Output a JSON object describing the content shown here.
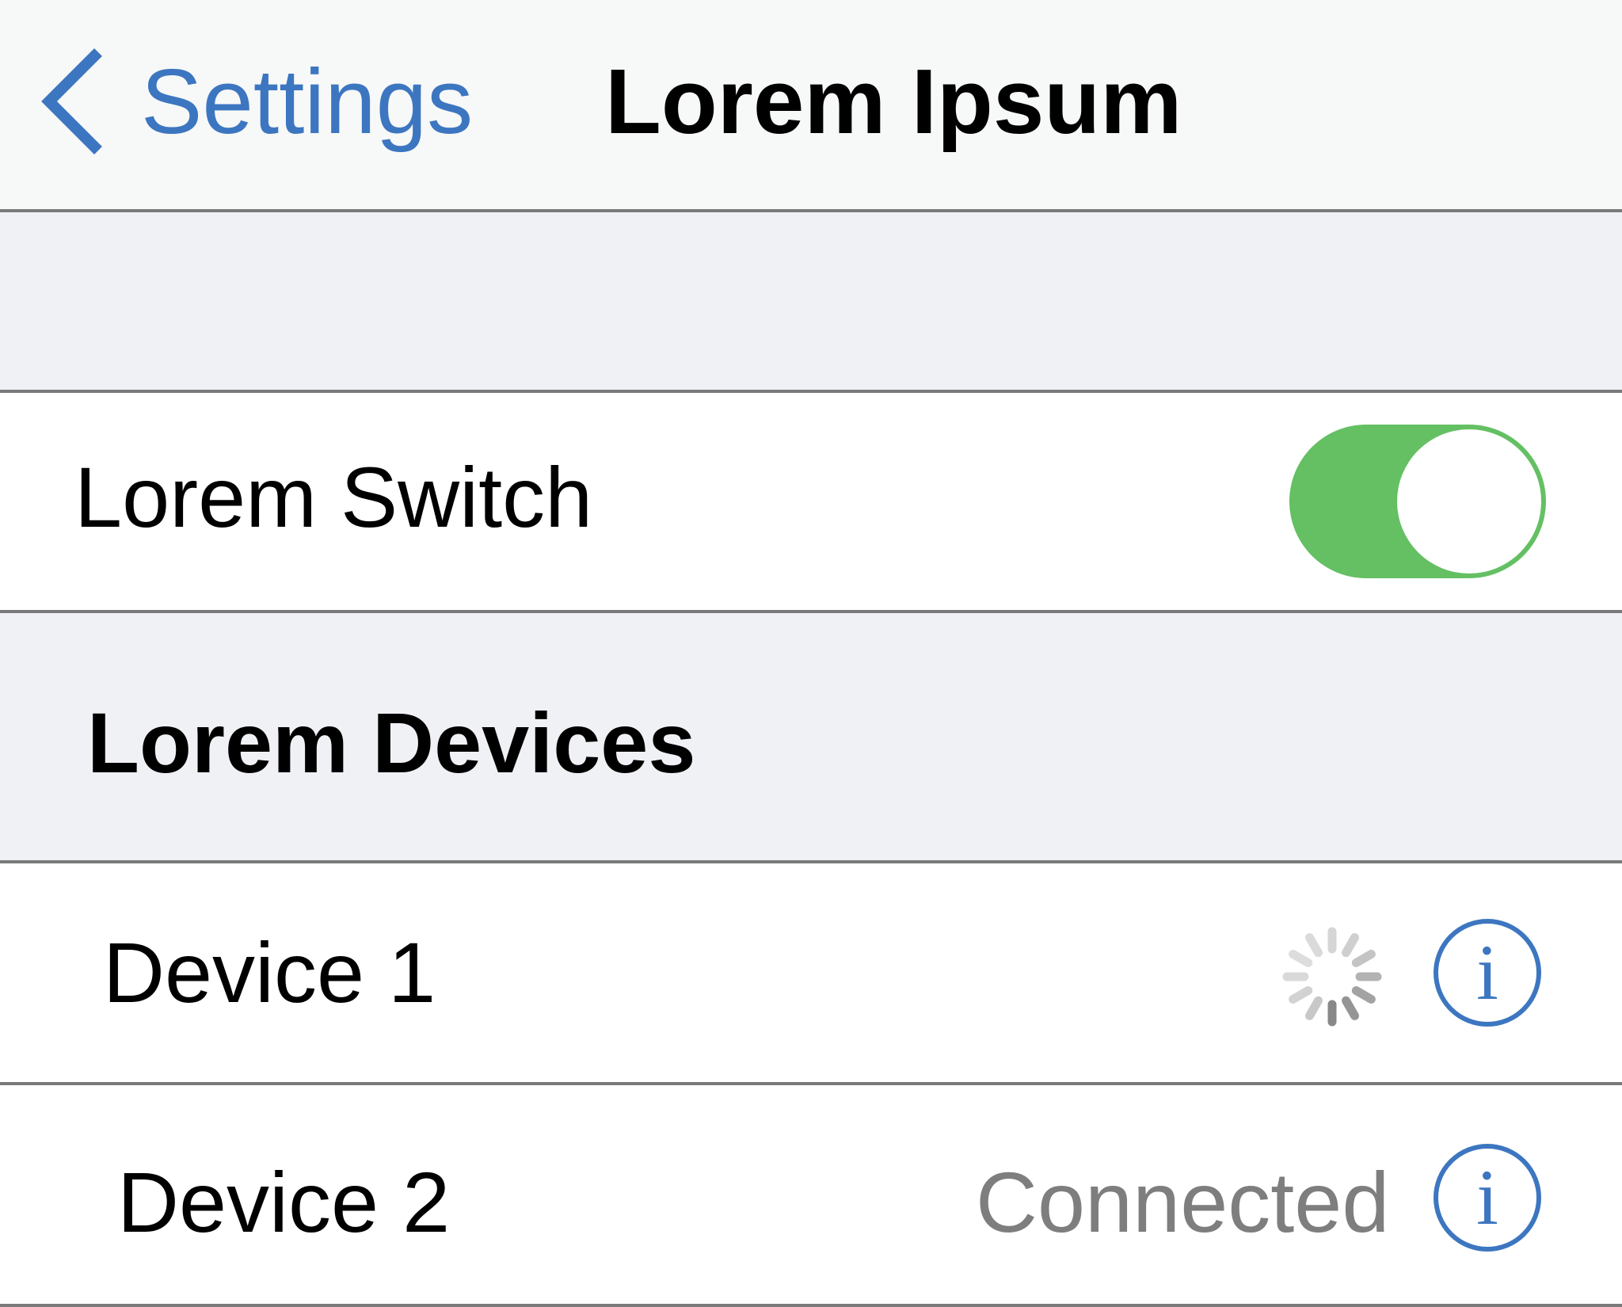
{
  "navbar": {
    "back_label": "Settings",
    "back_icon": "chevron-left-icon",
    "title": "Lorem Ipsum"
  },
  "switch_row": {
    "label": "Lorem Switch",
    "on": true
  },
  "devices_section": {
    "title": "Lorem Devices"
  },
  "devices": [
    {
      "name": "Device 1",
      "status": "",
      "state": "connecting"
    },
    {
      "name": "Device 2",
      "status": "Connected",
      "state": "connected"
    }
  ],
  "colors": {
    "accent": "#3d76c0",
    "switch_on": "#64c063",
    "secondary_text": "#7e7e7e",
    "grouped_bg": "#f0f1f5",
    "separator": "#7a7a7a"
  }
}
